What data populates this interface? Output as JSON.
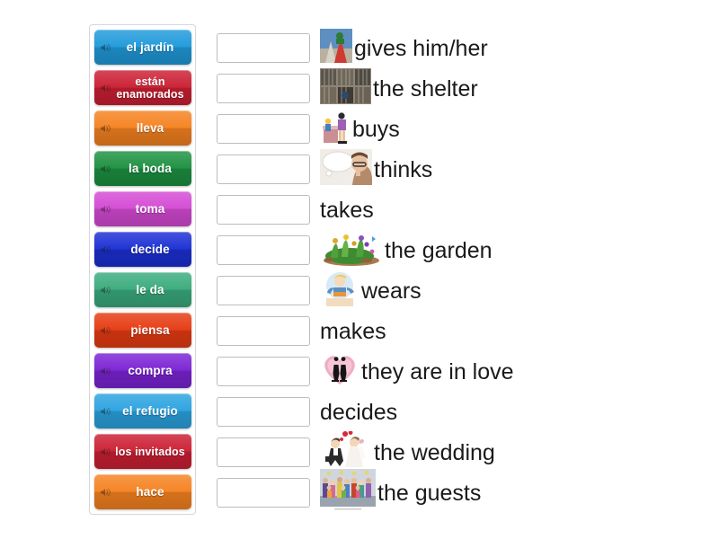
{
  "activity": {
    "type": "match-up",
    "language_pair": "Spanish-English"
  },
  "word_bank": {
    "name": "draggable-word-bank",
    "items": [
      {
        "label": "el jardín",
        "color": "#1f9ada",
        "icon": "speaker-icon",
        "lines": 1
      },
      {
        "label": "están enamorados",
        "color": "#cc1f33",
        "icon": "speaker-icon",
        "lines": 2
      },
      {
        "label": "lleva",
        "color": "#f58220",
        "icon": "speaker-icon",
        "lines": 1
      },
      {
        "label": "la boda",
        "color": "#1d9141",
        "icon": "speaker-icon",
        "lines": 1
      },
      {
        "label": "toma",
        "color": "#d44ad4",
        "icon": "speaker-icon",
        "lines": 1
      },
      {
        "label": "decide",
        "color": "#1c2fd4",
        "icon": "speaker-icon",
        "lines": 1
      },
      {
        "label": "le da",
        "color": "#3aab7d",
        "icon": "speaker-icon",
        "lines": 1
      },
      {
        "label": "piensa",
        "color": "#e63b12",
        "icon": "speaker-icon",
        "lines": 1
      },
      {
        "label": "compra",
        "color": "#7b23d4",
        "icon": "speaker-icon",
        "lines": 1
      },
      {
        "label": "el refugio",
        "color": "#2ba3e0",
        "icon": "speaker-icon",
        "lines": 1
      },
      {
        "label": "los invitados",
        "color": "#cc1f33",
        "icon": "speaker-icon",
        "lines": 2
      },
      {
        "label": "hace",
        "color": "#f58220",
        "icon": "speaker-icon",
        "lines": 1
      }
    ]
  },
  "answers": {
    "name": "answer-rows",
    "rows": [
      {
        "value": "",
        "image": "person-giving-gift-photo",
        "has_image": true,
        "text": "gives him/her"
      },
      {
        "value": "",
        "image": "animal-shelter-cages-photo",
        "has_image": true,
        "text": "the shelter"
      },
      {
        "value": "",
        "image": "woman-buying-at-counter-clipart",
        "has_image": true,
        "text": "buys"
      },
      {
        "value": "",
        "image": "woman-thinking-thought-bubble-photo",
        "has_image": true,
        "text": "thinks"
      },
      {
        "value": "",
        "image": "",
        "has_image": false,
        "text": "takes"
      },
      {
        "value": "",
        "image": "flower-garden-clipart",
        "has_image": true,
        "text": "the garden"
      },
      {
        "value": "",
        "image": "boy-wearing-clothes-clipart",
        "has_image": true,
        "text": "wears"
      },
      {
        "value": "",
        "image": "",
        "has_image": false,
        "text": "makes"
      },
      {
        "value": "",
        "image": "pink-heart-couple-clipart",
        "has_image": true,
        "text": "they are in love"
      },
      {
        "value": "",
        "image": "",
        "has_image": false,
        "text": "decides"
      },
      {
        "value": "",
        "image": "bride-and-groom-clipart",
        "has_image": true,
        "text": "the wedding"
      },
      {
        "value": "",
        "image": "crowd-of-guests-photo",
        "has_image": true,
        "text": "the guests"
      }
    ]
  },
  "colors": {
    "panel_border": "#d3d7dc",
    "drop_box_border": "#b9bdc2",
    "text": "#1a1a1a",
    "page_background": "#ffffff"
  }
}
